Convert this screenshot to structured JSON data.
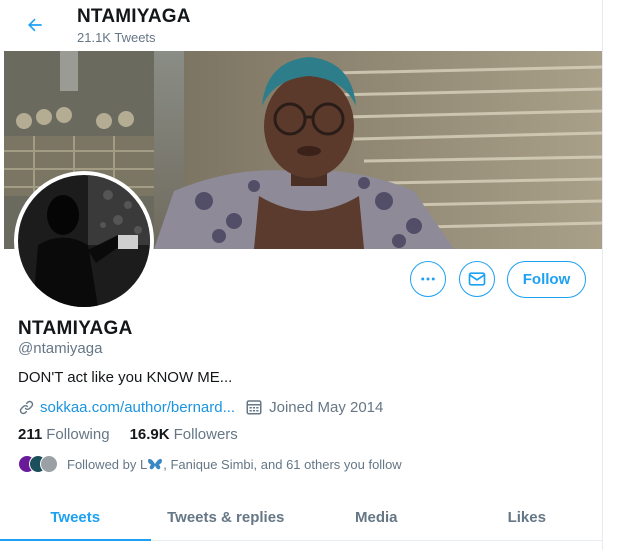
{
  "header": {
    "title": "NTAMIYAGA",
    "tweet_count": "21.1K Tweets"
  },
  "profile": {
    "name": "NTAMIYAGA",
    "handle": "@ntamiyaga",
    "bio": "DON'T act like you KNOW ME...",
    "link": "sokkaa.com/author/bernard...",
    "joined": "Joined May 2014",
    "following_count": "211",
    "following_label": "Following",
    "followers_count": "16.9K",
    "followers_label": "Followers",
    "followed_by_text": "Followed by L",
    "followed_by_rest": ", Fanique Simbi, and 61 others you follow"
  },
  "actions": {
    "follow_label": "Follow"
  },
  "tabs": [
    {
      "label": "Tweets",
      "active": true
    },
    {
      "label": "Tweets & replies",
      "active": false
    },
    {
      "label": "Media",
      "active": false
    },
    {
      "label": "Likes",
      "active": false
    }
  ],
  "colors": {
    "accent": "#1da1f2",
    "secondary_text": "#657786",
    "link": "#1b95e0"
  },
  "icons": [
    "back-arrow-icon",
    "more-icon",
    "mail-icon",
    "link-icon",
    "calendar-icon",
    "butterfly-emoji-icon"
  ]
}
